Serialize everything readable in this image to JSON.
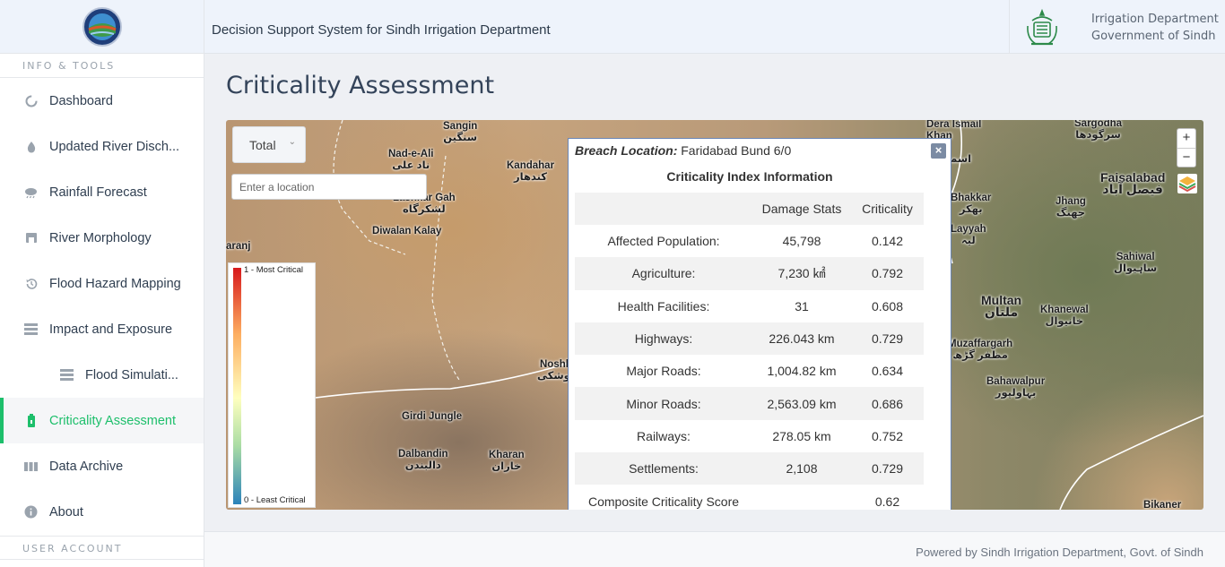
{
  "header": {
    "title": "Decision Support System for Sindh Irrigation Department",
    "dept_line1": "Irrigation Department",
    "dept_line2": "Government of Sindh"
  },
  "sidebar": {
    "section_info": "INFO & TOOLS",
    "section_user": "USER ACCOUNT",
    "items": [
      {
        "label": "Dashboard",
        "icon": "dashboard-icon"
      },
      {
        "label": "Updated River Disch...",
        "icon": "water-drop-icon"
      },
      {
        "label": "Rainfall Forecast",
        "icon": "rain-cloud-icon"
      },
      {
        "label": "River Morphology",
        "icon": "morphology-icon"
      },
      {
        "label": "Flood Hazard Mapping",
        "icon": "history-icon"
      },
      {
        "label": "Impact and Exposure",
        "icon": "layers-list-icon"
      },
      {
        "label": "Flood Simulati...",
        "icon": "layers-list-icon"
      },
      {
        "label": "Criticality Assessment",
        "icon": "battery-icon"
      },
      {
        "label": "Data Archive",
        "icon": "archive-icon"
      },
      {
        "label": "About",
        "icon": "info-icon"
      }
    ],
    "active_item": "Criticality Assessment",
    "accent_color": "#1dbf6b"
  },
  "main": {
    "page_title": "Criticality Assessment",
    "map": {
      "layer_select": "Total",
      "search_placeholder": "Enter a location",
      "legend_top": "1 - Most Critical",
      "legend_bottom": "0 - Least Critical",
      "zoom_in": "+",
      "zoom_out": "−",
      "labels": [
        {
          "name": "Sangin",
          "native": "سنگین"
        },
        {
          "name": "Nad-e-Ali",
          "native": "ناد علی"
        },
        {
          "name": "Kandahar",
          "native": "کندهار"
        },
        {
          "name": "Lashkar Gah",
          "native": "لشکرگاه"
        },
        {
          "name": "Diwalan Kalay",
          "native": ""
        },
        {
          "name": "Noshk",
          "native": "نوشکی"
        },
        {
          "name": "Girdi Jungle",
          "native": ""
        },
        {
          "name": "Dalbandin",
          "native": "دالبندن"
        },
        {
          "name": "Kharan",
          "native": "خاران"
        },
        {
          "name": "Dera Ismail Khan",
          "native": "ڈیرہ اسماعیل"
        },
        {
          "name": "Bhakkar",
          "native": "بھکر"
        },
        {
          "name": "Layyah",
          "native": "لیہ"
        },
        {
          "name": "Sargodha",
          "native": "سرگودھا"
        },
        {
          "name": "Faisalabad",
          "native": "فیصل آباد"
        },
        {
          "name": "Jhang",
          "native": "جھنگ"
        },
        {
          "name": "Sahiwal",
          "native": "ساہیوال"
        },
        {
          "name": "Multan",
          "native": "ملتان"
        },
        {
          "name": "Khanewal",
          "native": "خانیوال"
        },
        {
          "name": "Muzaffargarh",
          "native": "مظفر گڑھ"
        },
        {
          "name": "Bahawalpur",
          "native": "بہاولپور"
        },
        {
          "name": "Bikaner",
          "native": ""
        },
        {
          "name": "aranj",
          "native": ""
        }
      ]
    },
    "popup": {
      "location_label": "Breach Location:",
      "location_value": "Faridabad Bund 6/0",
      "subtitle": "Criticality Index Information",
      "close": "×",
      "columns": [
        "",
        "Damage Stats",
        "Criticality"
      ],
      "rows": [
        [
          "Affected Population:",
          "45,798",
          "0.142"
        ],
        [
          "Agriculture:",
          "7,230 ㎢",
          "0.792"
        ],
        [
          "Health Facilities:",
          "31",
          "0.608"
        ],
        [
          "Highways:",
          "226.043 km",
          "0.729"
        ],
        [
          "Major Roads:",
          "1,004.82 km",
          "0.634"
        ],
        [
          "Minor Roads:",
          "2,563.09 km",
          "0.686"
        ],
        [
          "Railways:",
          "278.05 km",
          "0.752"
        ],
        [
          "Settlements:",
          "2,108",
          "0.729"
        ],
        [
          "Composite Criticality Score",
          "",
          "0.62"
        ]
      ]
    }
  },
  "footer": {
    "text": "Powered by Sindh Irrigation Department, Govt. of Sindh"
  }
}
